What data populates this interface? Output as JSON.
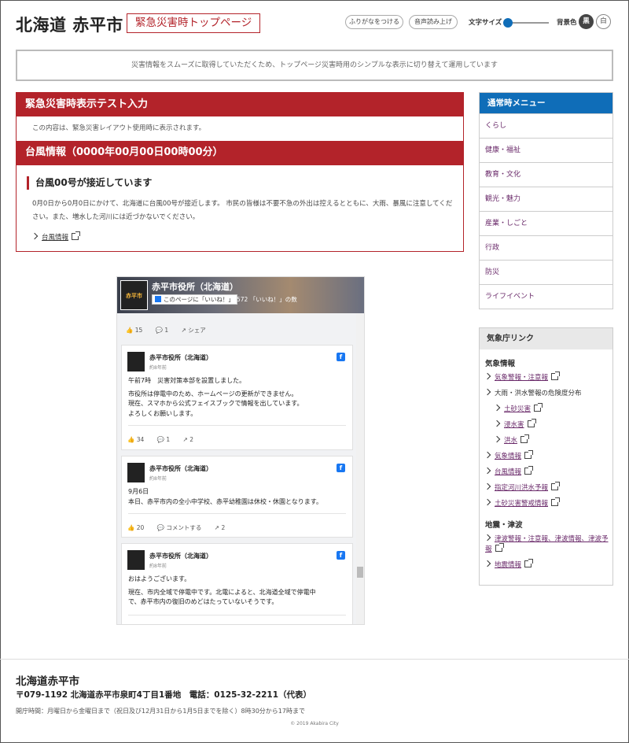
{
  "header": {
    "site_title": "北海道 赤平市",
    "emergency_tag": "緊急災害時トップページ",
    "furigana_button": "ふりがなをつける",
    "voice_button": "音声読み上げ",
    "font_size_label": "文字サイズ",
    "bg_color_label": "背景色",
    "bg_black": "黒",
    "bg_white": "白"
  },
  "notice": "災害情報をスムーズに取得していただくため、トップページ災害時用のシンプルな表示に切り替えて運用しています",
  "main": {
    "test_title": "緊急災害時表示テスト入力",
    "test_note": "この内容は、緊急災害レイアウト使用時に表示されます。",
    "typhoon_title": "台風情報（0000年00月00日00時00分）",
    "alert_heading": "台風00号が接近しています",
    "alert_body": "0月0日から0月0日にかけて、北海道に台風00号が接近します。 市民の皆様は不要不急の外出は控えるとともに、大雨、暴風に注意してください。また、増水した河川には近づかないでください。",
    "alert_link": "台風情報"
  },
  "facebook": {
    "page_name": "赤平市役所（北海道）",
    "logo_text": "赤平市",
    "like_button": "このページに「いいね！」",
    "like_count": "572 「いいね！」の数",
    "top_stats": {
      "likes": "15",
      "comments": "1",
      "share": "シェア"
    },
    "posts": [
      {
        "name": "赤平市役所（北海道）",
        "time": "約8年前",
        "lines": [
          "午前7時　災害対策本部を設置しました。",
          "",
          "市役所は停電中のため、ホームページの更新ができません。",
          "現在、スマホから公式フェイスブックで情報を出しています。",
          "よろしくお願いします。"
        ],
        "likes": "34",
        "comments": "1",
        "shares": "2"
      },
      {
        "name": "赤平市役所（北海道）",
        "time": "約8年前",
        "lines": [
          "9月6日",
          "本日、赤平市内の全小中学校、赤平幼稚園は休校・休園となります。"
        ],
        "likes": "20",
        "comments": "コメントする",
        "shares": "2"
      },
      {
        "name": "赤平市役所（北海道）",
        "time": "約8年前",
        "lines": [
          "おはようございます。",
          "",
          "現在、市内全域で停電中です。北電によると、北海道全域で停電中",
          "で、赤平市内の復旧のめどはたっていないそうです。"
        ]
      }
    ]
  },
  "sidebar": {
    "menu_title": "通常時メニュー",
    "menu_items": [
      "くらし",
      "健康・福祉",
      "教育・文化",
      "観光・魅力",
      "産業・しごと",
      "行政",
      "防災",
      "ライフイベント"
    ],
    "jma_title": "気象庁リンク",
    "weather_section": "気象情報",
    "weather_links": [
      {
        "label": "気象警報・注意報",
        "sub": false,
        "link": true
      },
      {
        "label": "大雨・洪水警報の危険度分布",
        "sub": false,
        "link": false
      },
      {
        "label": "土砂災害",
        "sub": true,
        "link": true
      },
      {
        "label": "浸水害",
        "sub": true,
        "link": true
      },
      {
        "label": "洪水",
        "sub": true,
        "link": true
      },
      {
        "label": "気象情報",
        "sub": false,
        "link": true
      },
      {
        "label": "台風情報",
        "sub": false,
        "link": true
      },
      {
        "label": "指定河川洪水予報",
        "sub": false,
        "link": true
      },
      {
        "label": "土砂災害警戒情報",
        "sub": false,
        "link": true
      }
    ],
    "quake_section": "地震・津波",
    "quake_links": [
      {
        "label": "津波警報・注意報、津波情報、津波予報",
        "sub": false,
        "link": true
      },
      {
        "label": "地震情報",
        "sub": false,
        "link": true
      }
    ]
  },
  "footer": {
    "name": "北海道赤平市",
    "address": "〒079-1192 北海道赤平市泉町4丁目1番地　電話：0125-32-2211（代表）",
    "hours": "開庁時間：月曜日から金曜日まで（祝日及び12月31日から1月5日までを除く）8時30分から17時まで",
    "copyright": "© 2019 Akabira City"
  },
  "colors": {
    "accent_red": "#b3232a",
    "accent_blue": "#0f6db8",
    "link_purple": "#6a2a6a"
  }
}
